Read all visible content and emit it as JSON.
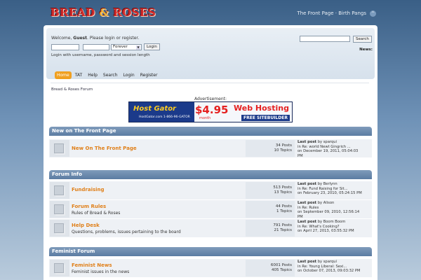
{
  "header": {
    "logo_text_1": "BREAD",
    "logo_amp": "&",
    "logo_text_2": "ROSES",
    "tagline": "The Front Page · Birth Pangs",
    "collapse_glyph": "^"
  },
  "userbox": {
    "welcome_prefix": "Welcome,",
    "guest": "Guest",
    "welcome_suffix": ". Please login or register.",
    "session_select": "Forever",
    "login_button": "Login",
    "login_hint": "Login with username, password and session length",
    "search_button": "Search",
    "news_label": "News:"
  },
  "menu": [
    "Home",
    "TAT",
    "Help",
    "Search",
    "Login",
    "Register"
  ],
  "breadcrumb": "Bread & Roses Forum",
  "ad": {
    "label": "Advertisement:",
    "brand": "Host Gator",
    "phone": "HostGator.com 1-866-96-GATOR",
    "price": "$4.95",
    "period": "month",
    "headline": "Web Hosting",
    "sub": "FREE SITEBUILDER"
  },
  "categories": [
    {
      "title": "New on The Front Page",
      "boards": [
        {
          "name": "New On The Front Page",
          "desc": "",
          "posts": "34 Posts",
          "topics": "10 Topics",
          "last_label": "Last post",
          "last_by": "by sparqui",
          "last_in": "in Re: world Newt Gingrich ...",
          "last_on": "on December 19, 2011, 05:04:03",
          "last_ampm": "PM"
        }
      ]
    },
    {
      "title": "Forum Info",
      "boards": [
        {
          "name": "Fundraising",
          "desc": "",
          "posts": "513 Posts",
          "topics": "13 Topics",
          "last_label": "Last post",
          "last_by": "by Berlynn",
          "last_in": "in Re: Fund Raising for Sit...",
          "last_on": "on February 23, 2010, 05:24:15 PM",
          "last_ampm": ""
        },
        {
          "name": "Forum Rules",
          "desc": "Rules of Bread & Roses",
          "posts": "44 Posts",
          "topics": "1 Topics",
          "last_label": "Last post",
          "last_by": "by Alison",
          "last_in": "in Re: Rules",
          "last_on": "on September 09, 2010, 12:56:14",
          "last_ampm": "PM"
        },
        {
          "name": "Help Desk",
          "desc": "Questions, problems, issues pertaining to the board",
          "posts": "791 Posts",
          "topics": "21 Topics",
          "last_label": "Last post",
          "last_by": "by Boom Boom",
          "last_in": "in Re: What's Cooking?",
          "last_on": "on April 27, 2013, 03:55:32 PM",
          "last_ampm": ""
        }
      ]
    },
    {
      "title": "Feminist Forum",
      "boards": [
        {
          "name": "Feminist News",
          "desc": "Feminist issues in the news",
          "posts": "6001 Posts",
          "topics": "405 Topics",
          "last_label": "Last post",
          "last_by": "by sparqui",
          "last_in": "in Re: Young Liberal: Sexi...",
          "last_on": "on October 07, 2013, 09:03:32 PM",
          "last_ampm": ""
        }
      ]
    }
  ]
}
